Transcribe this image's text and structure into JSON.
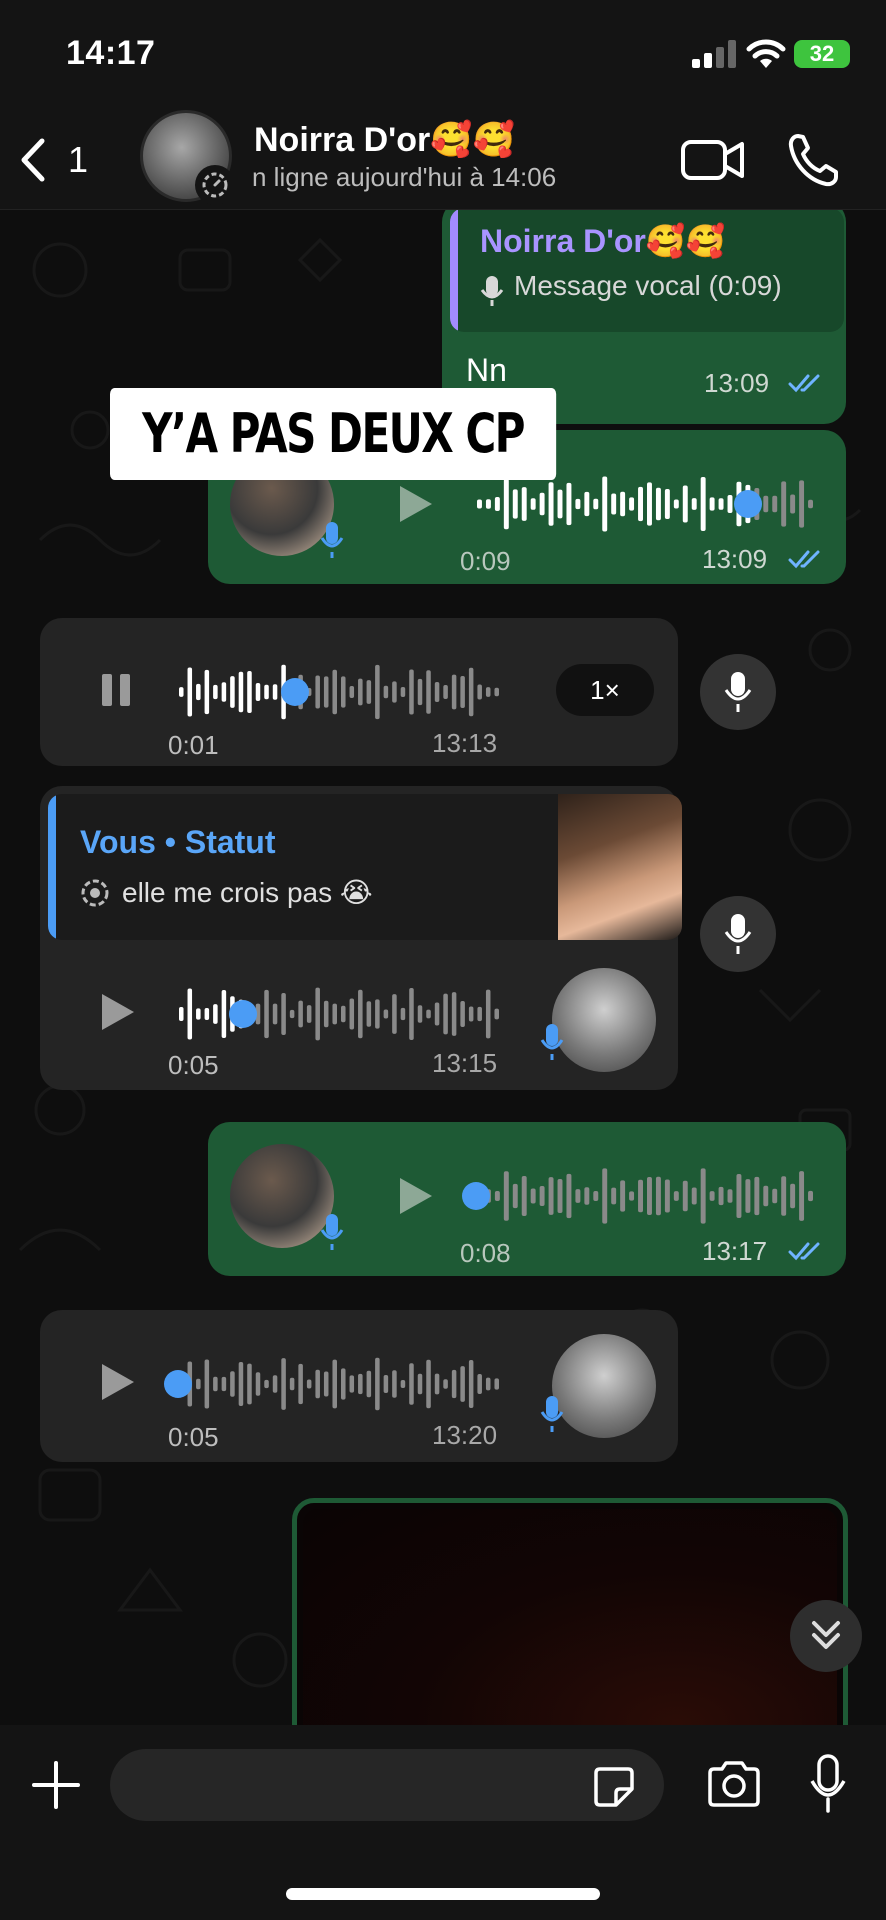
{
  "status_bar": {
    "time": "14:17",
    "battery": "32"
  },
  "header": {
    "back_count": "1",
    "contact_name": "Noirra D'or🥰🥰",
    "last_seen": "n ligne aujourd'hui à 14:06"
  },
  "messages": {
    "m1": {
      "quote_name": "Noirra D'or🥰🥰",
      "quote_text": "Message vocal (0:09)",
      "text": "Nn",
      "time": "13:09"
    },
    "m2": {
      "duration": "0:09",
      "time": "13:09",
      "progress": 0.8
    },
    "m3": {
      "duration": "0:01",
      "time": "13:13",
      "speed": "1×",
      "progress": 0.36
    },
    "m4": {
      "status_title": "Vous • Statut",
      "status_text": "elle me crois pas 😭",
      "duration": "0:05",
      "time": "13:15",
      "progress": 0.2
    },
    "m5": {
      "duration": "0:08",
      "time": "13:17",
      "progress": 0.0
    },
    "m6": {
      "duration": "0:05",
      "time": "13:20",
      "progress": 0.0
    }
  },
  "overlay_caption": "Y’A PAS DEUX CP",
  "composer": {
    "placeholder": ""
  },
  "colors": {
    "outgoing": "#1e5a35",
    "incoming": "#242424",
    "accent_blue": "#4b9cf5",
    "quote_purple": "#a994ff"
  },
  "icons": [
    "back-chevron-icon",
    "video-call-icon",
    "phone-icon",
    "mic-icon",
    "play-icon",
    "pause-icon",
    "plus-icon",
    "sticker-icon",
    "camera-icon",
    "double-chevron-down-icon",
    "double-check-icon",
    "status-ring-icon"
  ]
}
